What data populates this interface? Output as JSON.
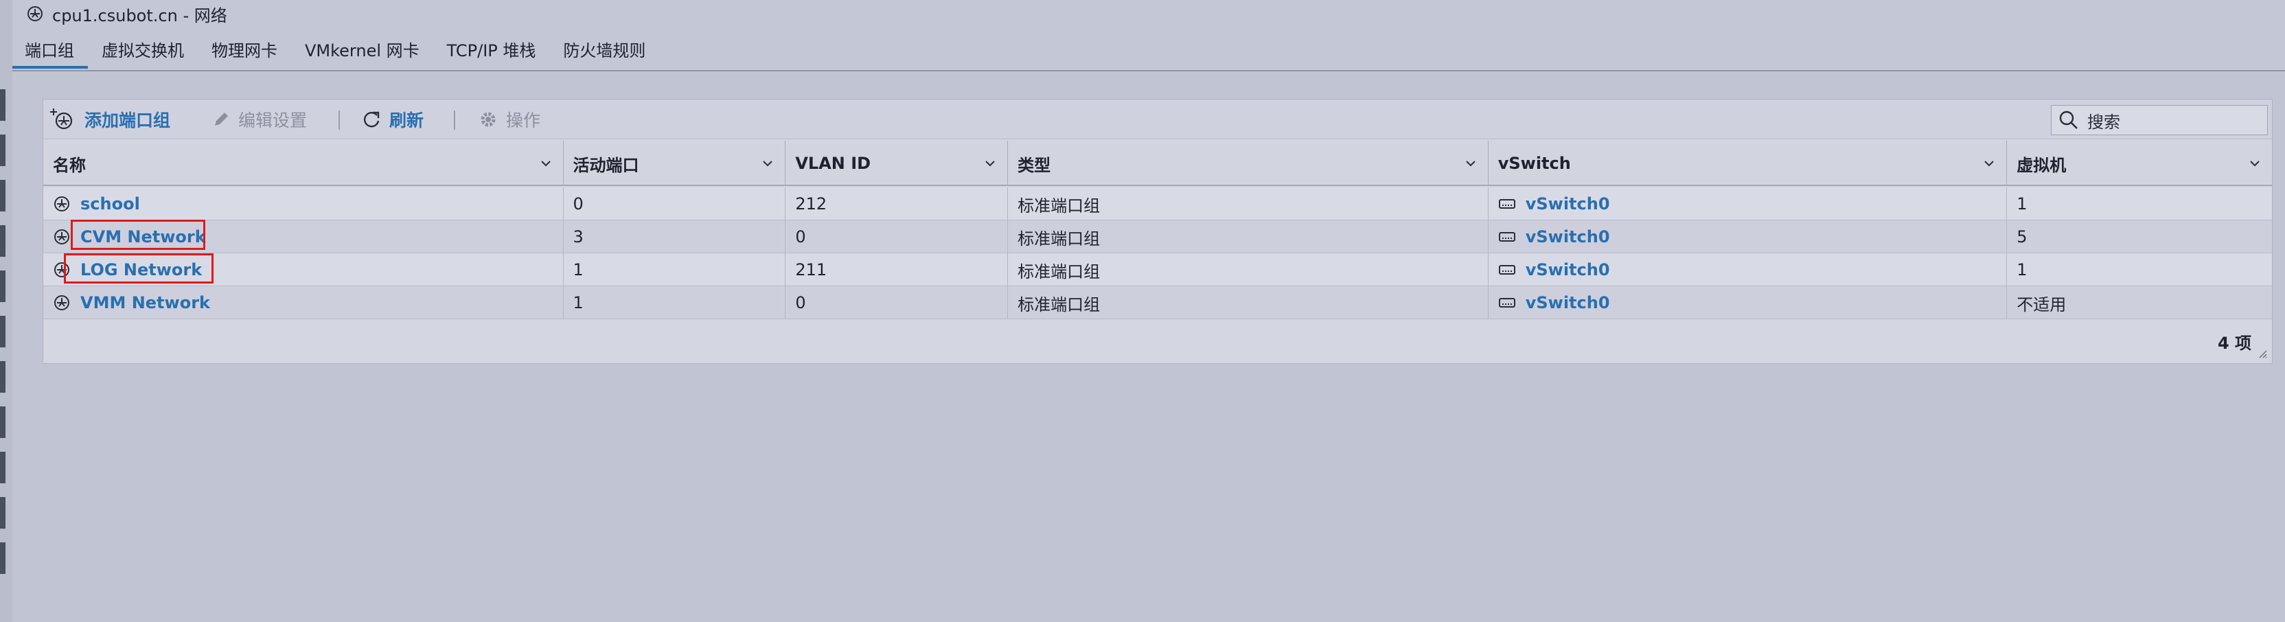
{
  "window": {
    "title": "cpu1.csubot.cn - 网络"
  },
  "tabs": [
    {
      "label": "端口组"
    },
    {
      "label": "虚拟交换机"
    },
    {
      "label": "物理网卡"
    },
    {
      "label": "VMkernel 网卡"
    },
    {
      "label": "TCP/IP 堆栈"
    },
    {
      "label": "防火墙规则"
    }
  ],
  "toolbar": {
    "add_label": "添加端口组",
    "edit_label": "编辑设置",
    "refresh_label": "刷新",
    "actions_label": "操作",
    "search_placeholder": "搜索"
  },
  "table": {
    "columns": [
      "名称",
      "活动端口",
      "VLAN ID",
      "类型",
      "vSwitch",
      "虚拟机"
    ],
    "rows": [
      {
        "name": "school",
        "active_ports": "0",
        "vlan": "212",
        "type": "标准端口组",
        "vswitch": "vSwitch0",
        "vms": "1"
      },
      {
        "name": "CVM Network",
        "active_ports": "3",
        "vlan": "0",
        "type": "标准端口组",
        "vswitch": "vSwitch0",
        "vms": "5"
      },
      {
        "name": "LOG Network",
        "active_ports": "1",
        "vlan": "211",
        "type": "标准端口组",
        "vswitch": "vSwitch0",
        "vms": "1"
      },
      {
        "name": "VMM Network",
        "active_ports": "1",
        "vlan": "0",
        "type": "标准端口组",
        "vswitch": "vSwitch0",
        "vms": "不适用"
      }
    ],
    "footer_count": "4 项"
  },
  "icons": {
    "network": "network-portgroup-icon",
    "switch": "vswitch-icon"
  },
  "colors": {
    "link": "#2a6fb0",
    "highlight": "#e01a1a"
  }
}
